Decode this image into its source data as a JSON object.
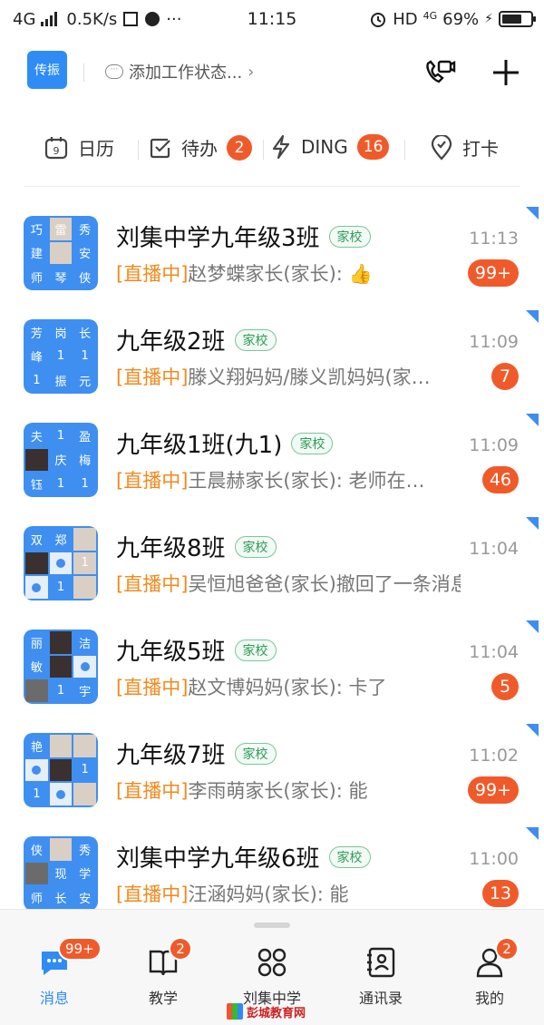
{
  "status_bar": {
    "network": "4G",
    "speed": "0.5K/s",
    "time": "11:15",
    "hd": "HD",
    "net2": "4G",
    "battery": "69%",
    "battery_level": 0.69
  },
  "header": {
    "corp_logo": "传振",
    "work_status": "添加工作状态...",
    "video_icon": "video-call-icon",
    "add_icon": "plus-icon"
  },
  "quick_bar": {
    "calendar": {
      "label": "日历",
      "icon": "calendar-icon"
    },
    "todo": {
      "label": "待办",
      "badge": "2",
      "icon": "checkbox-icon"
    },
    "ding": {
      "label": "DING",
      "badge": "16",
      "icon": "lightning-icon"
    },
    "checkin": {
      "label": "打卡",
      "icon": "location-pin-icon"
    }
  },
  "chats": [
    {
      "name": "刘集中学九年级3班",
      "tag": "家校",
      "time": "11:13",
      "live": "[直播中]",
      "message": "赵梦蝶家长(家长): 👍",
      "badge": "99+",
      "tiles": [
        "巧",
        "雷",
        "秀",
        "建",
        "",
        "安",
        "师",
        "琴",
        "侠"
      ]
    },
    {
      "name": "九年级2班",
      "tag": "家校",
      "time": "11:09",
      "live": "[直播中]",
      "message": "滕义翔妈妈/滕义凯妈妈(家…",
      "badge": "7",
      "tiles": [
        "芳",
        "岗",
        "长",
        "峰",
        "1",
        "1",
        "1",
        "振",
        "元"
      ]
    },
    {
      "name": "九年级1班(九1)",
      "tag": "家校",
      "time": "11:09",
      "live": "[直播中]",
      "message": "王晨赫家长(家长): 老师在…",
      "badge": "46",
      "tiles": [
        "夫",
        "1",
        "盈",
        "",
        "庆",
        "梅",
        "钰",
        "1",
        "1"
      ]
    },
    {
      "name": "九年级8班",
      "tag": "家校",
      "time": "11:04",
      "live": "[直播中]",
      "message": "吴恒旭爸爸(家长)撤回了一条消息",
      "badge": "",
      "tiles": [
        "双",
        "郑",
        "",
        "",
        "",
        "1",
        "",
        "1",
        ""
      ]
    },
    {
      "name": "九年级5班",
      "tag": "家校",
      "time": "11:04",
      "live": "[直播中]",
      "message": "赵文博妈妈(家长): 卡了",
      "badge": "5",
      "tiles": [
        "丽",
        "",
        "洁",
        "敏",
        "",
        "",
        "",
        "1",
        "宇"
      ]
    },
    {
      "name": "九年级7班",
      "tag": "家校",
      "time": "11:02",
      "live": "[直播中]",
      "message": "李雨萌家长(家长): 能",
      "badge": "99+",
      "tiles": [
        "艳",
        "",
        "",
        "",
        "",
        "1",
        "1",
        "",
        ""
      ]
    },
    {
      "name": "刘集中学九年级6班",
      "tag": "家校",
      "time": "11:00",
      "live": "[直播中]",
      "message": "汪涵妈妈(家长): 能",
      "badge": "13",
      "tiles": [
        "侠",
        "",
        "秀",
        "",
        "现",
        "学",
        "师",
        "长",
        "安"
      ]
    }
  ],
  "tabs": [
    {
      "label": "消息",
      "badge": "99+",
      "icon": "chat-bubble-icon"
    },
    {
      "label": "教学",
      "badge": "2",
      "icon": "book-icon"
    },
    {
      "label": "刘集中学",
      "badge": "",
      "icon": "grid-apps-icon"
    },
    {
      "label": "通讯录",
      "badge": "",
      "icon": "contacts-icon"
    },
    {
      "label": "我的",
      "badge": "2",
      "icon": "person-icon"
    }
  ],
  "watermark": "彭城教育网"
}
